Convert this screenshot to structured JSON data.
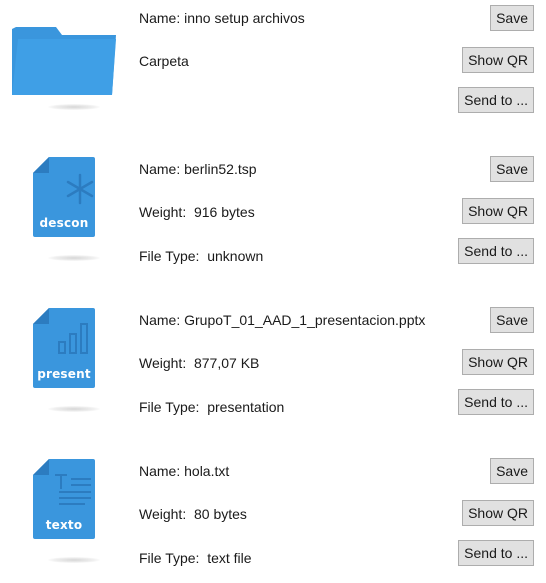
{
  "buttons": {
    "save": "Save",
    "show_qr": "Show QR",
    "send_to": "Send to ..."
  },
  "colors": {
    "icon_blue": "#3a96dd",
    "icon_fold": "#2c7cc0"
  },
  "items": [
    {
      "kind": "folder",
      "icon": "folder-icon",
      "name_line": "Name: inno setup archivos",
      "type_line": "Carpeta"
    },
    {
      "kind": "file",
      "icon": "asterisk-document-icon",
      "icon_label": "descon",
      "name_line": "Name: berlin52.tsp",
      "weight_line": "Weight:  916 bytes",
      "type_line": "File Type:  unknown"
    },
    {
      "kind": "file",
      "icon": "bar-chart-document-icon",
      "icon_label": "present",
      "name_line": "Name: GrupoT_01_AAD_1_presentacion.pptx",
      "weight_line": "Weight:  877,07 KB",
      "type_line": "File Type:  presentation"
    },
    {
      "kind": "file",
      "icon": "text-document-icon",
      "icon_label": "texto",
      "name_line": "Name: hola.txt",
      "weight_line": "Weight:  80 bytes",
      "type_line": "File Type:  text file"
    }
  ]
}
